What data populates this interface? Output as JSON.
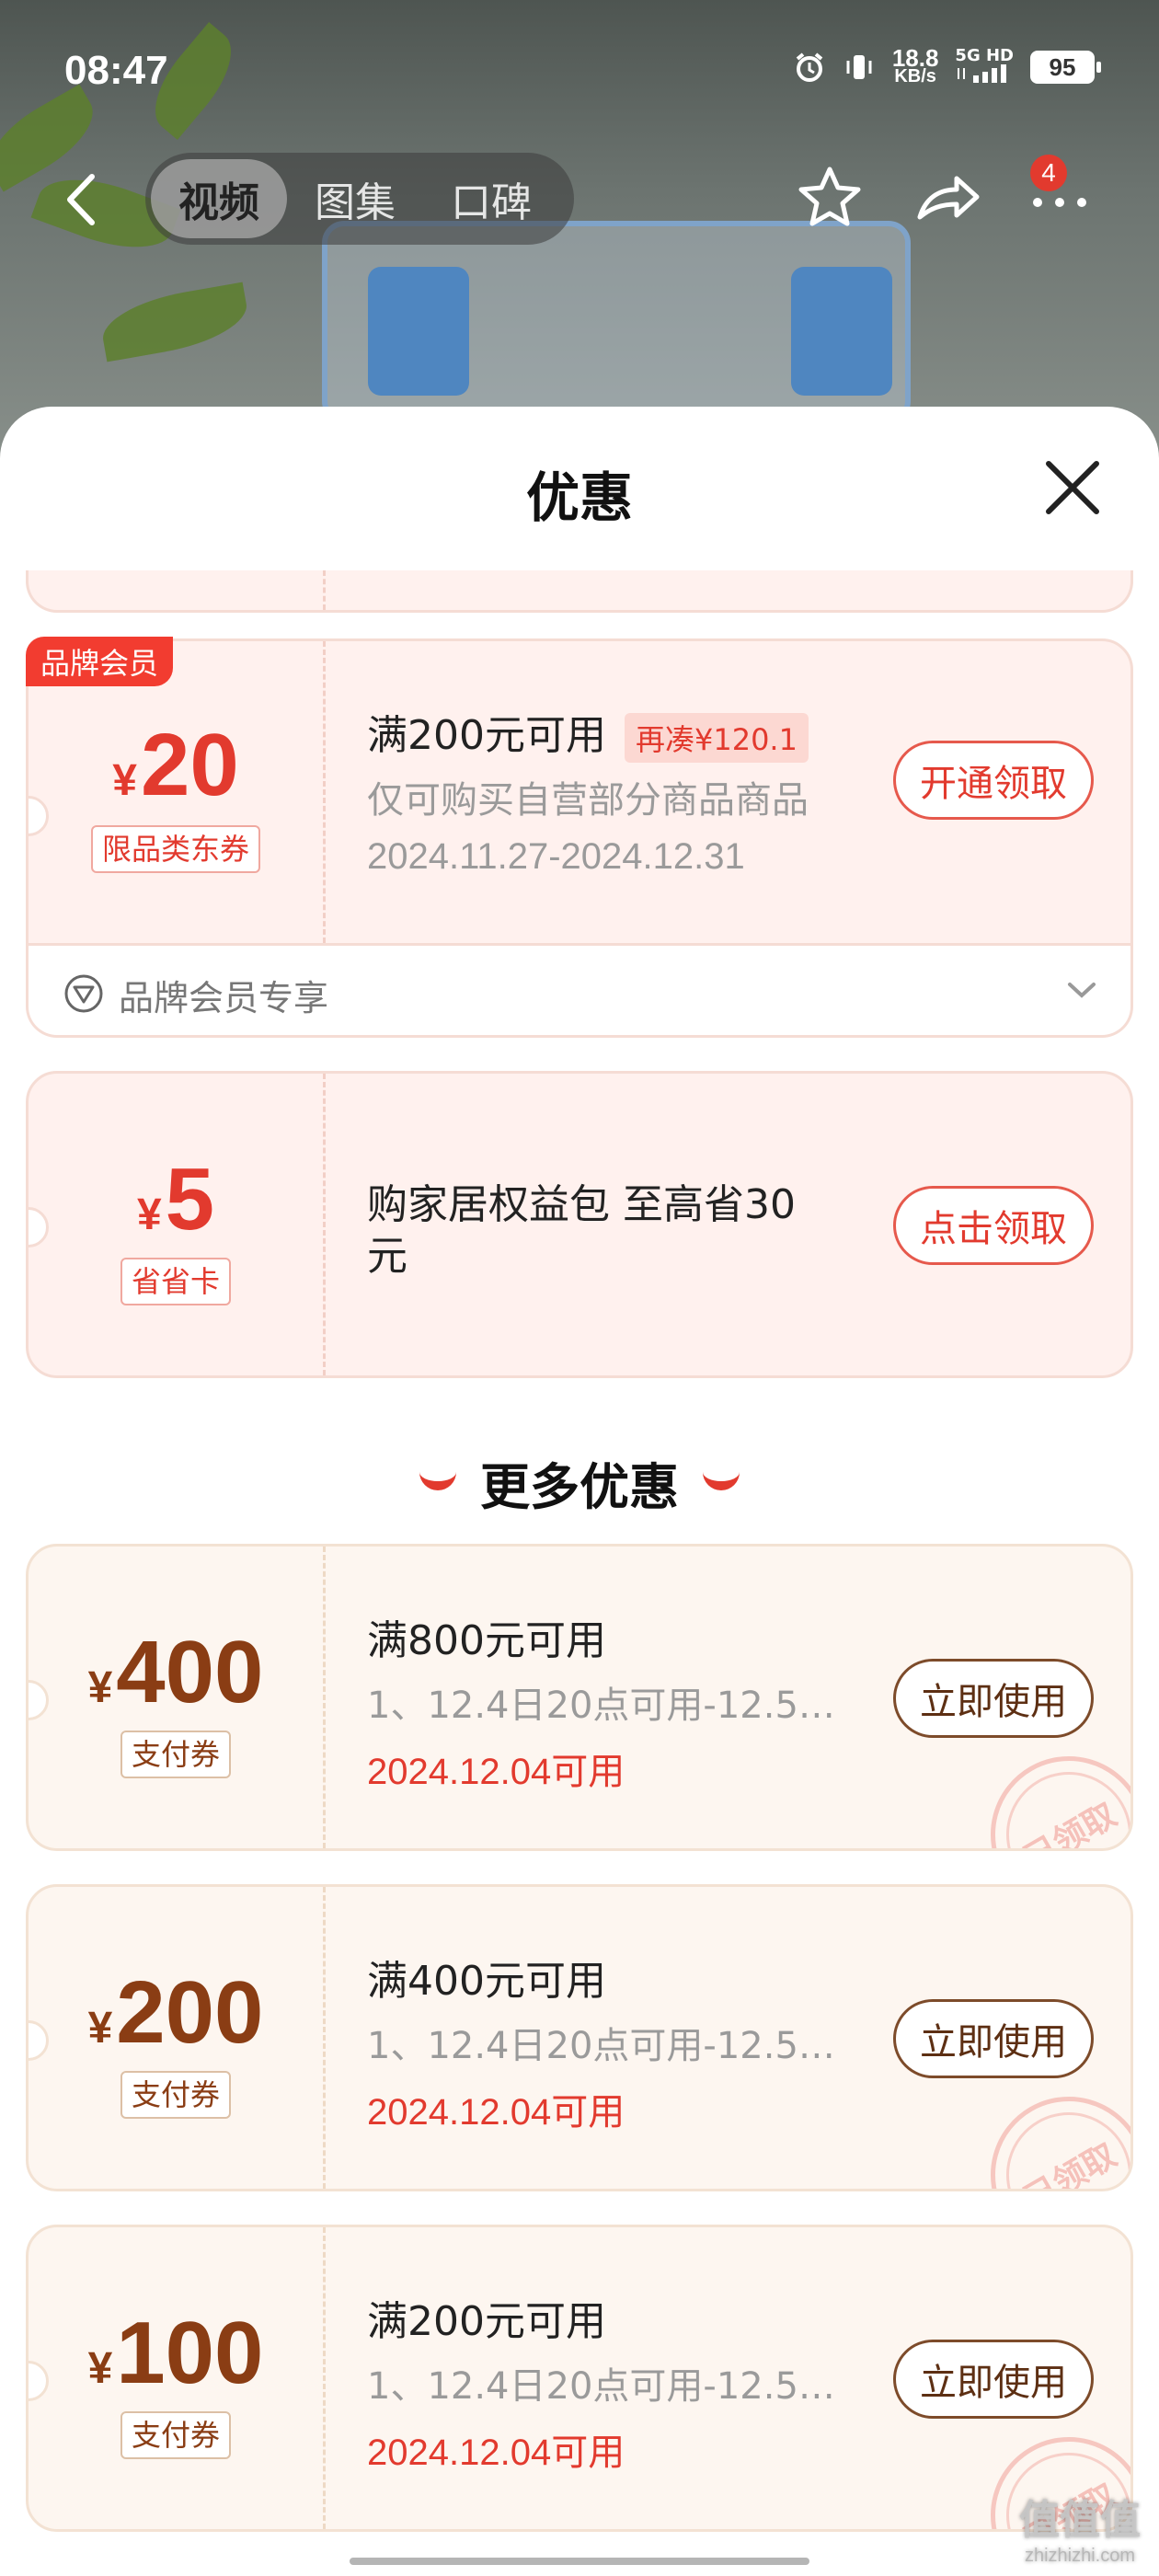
{
  "status_bar": {
    "time": "08:47",
    "speed_value": "18.8",
    "speed_unit": "KB/s",
    "network": "5G HD",
    "battery": "95"
  },
  "nav": {
    "tabs": [
      {
        "label": "视频",
        "active": true
      },
      {
        "label": "图集",
        "active": false
      },
      {
        "label": "口碑",
        "active": false
      }
    ],
    "more_badge": "4"
  },
  "sheet": {
    "title": "优惠"
  },
  "coupons_top": [
    {
      "corner_tag": "品牌会员",
      "currency": "¥",
      "amount": "20",
      "type": "限品类东券",
      "condition": "满200元可用",
      "extra": "再凑¥120.1",
      "desc": "仅可购买自营部分商品商品",
      "date": "2024.11.27-2024.12.31",
      "button": "开通领取",
      "footer": "品牌会员专享"
    },
    {
      "currency": "¥",
      "amount": "5",
      "type": "省省卡",
      "desc_line1": "购家居权益包 至高省30",
      "desc_line2": "元",
      "button": "点击领取"
    }
  ],
  "more_section": {
    "title": "更多优惠"
  },
  "coupons_more": [
    {
      "currency": "¥",
      "amount": "400",
      "type": "支付券",
      "condition": "满800元可用",
      "desc": "1、12.4日20点可用-12.5…",
      "date": "2024.12.04可用",
      "button": "立即使用",
      "stamp": "已领取"
    },
    {
      "currency": "¥",
      "amount": "200",
      "type": "支付券",
      "condition": "满400元可用",
      "desc": "1、12.4日20点可用-12.5…",
      "date": "2024.12.04可用",
      "button": "立即使用",
      "stamp": "已领取"
    },
    {
      "currency": "¥",
      "amount": "100",
      "type": "支付券",
      "condition": "满200元可用",
      "desc": "1、12.4日20点可用-12.5…",
      "date": "2024.12.04可用",
      "button": "立即使用",
      "stamp": "已领取"
    }
  ],
  "watermark": {
    "logo": "值值值",
    "site": "zhizhizhi.com"
  },
  "colors": {
    "accent_red": "#e23a2e",
    "gold_brown": "#8a3d14"
  }
}
